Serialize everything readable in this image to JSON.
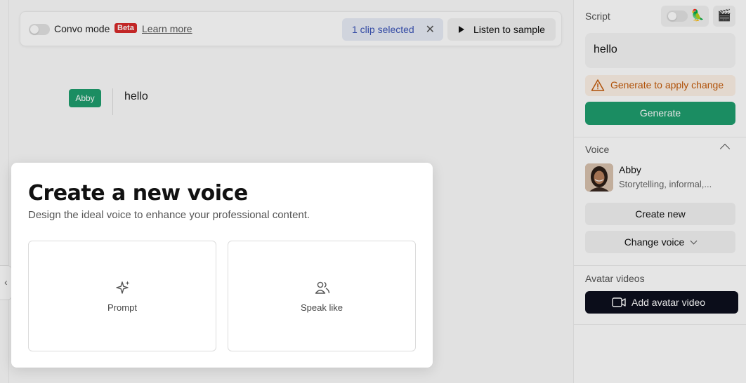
{
  "toolbar": {
    "convo_mode_label": "Convo mode",
    "beta_badge": "Beta",
    "learn_more": "Learn more",
    "clip_selected": "1 clip selected",
    "listen_label": "Listen to sample"
  },
  "clip": {
    "speaker": "Abby",
    "text": "hello"
  },
  "sidebar": {
    "script_label": "Script",
    "script_text": "hello",
    "warning_text": "Generate to apply change",
    "generate_label": "Generate",
    "voice_label": "Voice",
    "voice_name": "Abby",
    "voice_desc": "Storytelling, informal,...",
    "create_new_label": "Create new",
    "change_voice_label": "Change voice",
    "avatar_videos_label": "Avatar videos",
    "add_avatar_label": "Add avatar video"
  },
  "modal": {
    "title": "Create a new voice",
    "subtitle": "Design the ideal voice to enhance your professional content.",
    "options": [
      {
        "label": "Prompt",
        "icon": "sparkle-icon"
      },
      {
        "label": "Speak like",
        "icon": "people-icon"
      }
    ]
  },
  "colors": {
    "accent_green": "#1f9e6e",
    "beta_red": "#d92b2b",
    "warning_orange": "#c45b0a",
    "dark_button": "#0d0f1e"
  }
}
